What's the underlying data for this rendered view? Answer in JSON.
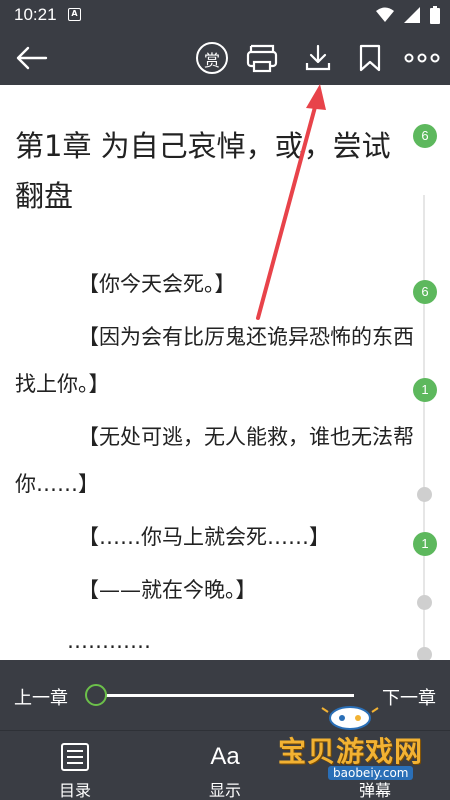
{
  "status_bar": {
    "time": "10:21",
    "notification_glyph": "A"
  },
  "toolbar": {
    "icons": [
      "back-arrow-icon",
      "reward-icon",
      "listen-icon",
      "download-icon",
      "bookmark-icon",
      "more-icon"
    ],
    "reward_glyph": "赏"
  },
  "content": {
    "chapter_title": "第1章 为自己哀悼，或，尝试翻盘",
    "paragraphs": [
      "【你今天会死。】",
      "【因为会有比厉鬼还诡异恐怖的东西找上你。】",
      "【无处可逃，无人能救，谁也无法帮你……】",
      "【……你马上就会死……】",
      "【——就在今晚。】",
      "…………"
    ],
    "comment_badges": [
      "6",
      "6",
      "1",
      "1"
    ]
  },
  "progress": {
    "prev_label": "上一章",
    "next_label": "下一章",
    "position": 0
  },
  "bottom_bar": {
    "toc_label": "目录",
    "display_label": "显示",
    "third_label": "弹幕"
  },
  "watermark": {
    "text": "宝贝游戏网",
    "url": "baobeiy.com"
  },
  "colors": {
    "bar_bg": "#3a3d44",
    "badge_green": "#5db85d",
    "slider_thumb": "#6cc04a",
    "arrow_red": "#e8434a"
  }
}
